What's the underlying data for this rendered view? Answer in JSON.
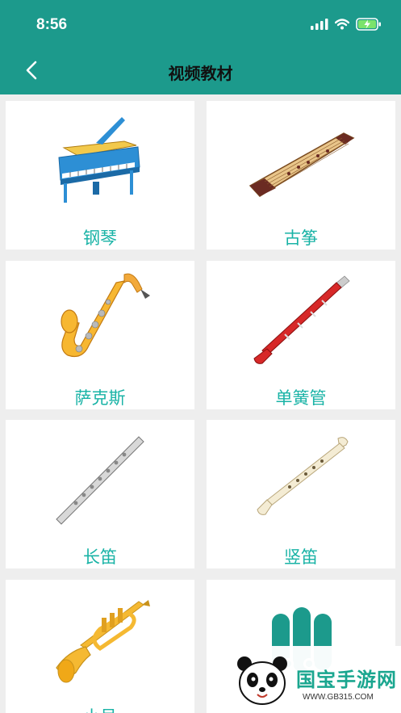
{
  "status": {
    "time": "8:56"
  },
  "header": {
    "title": "视频教材"
  },
  "instruments": [
    {
      "label": "钢琴",
      "icon": "piano-icon"
    },
    {
      "label": "古筝",
      "icon": "guzheng-icon"
    },
    {
      "label": "萨克斯",
      "icon": "saxophone-icon"
    },
    {
      "label": "单簧管",
      "icon": "clarinet-icon"
    },
    {
      "label": "长笛",
      "icon": "flute-icon"
    },
    {
      "label": "竖笛",
      "icon": "recorder-icon"
    },
    {
      "label": "小号",
      "icon": "trumpet-icon"
    },
    {
      "label": "",
      "icon": "app-logo-icon"
    }
  ],
  "watermark": {
    "brand": "国宝手游网",
    "url": "WWW.GB315.COM"
  },
  "colors": {
    "header": "#1c9a8c",
    "label": "#19b3a6",
    "background": "#eeeeee"
  }
}
